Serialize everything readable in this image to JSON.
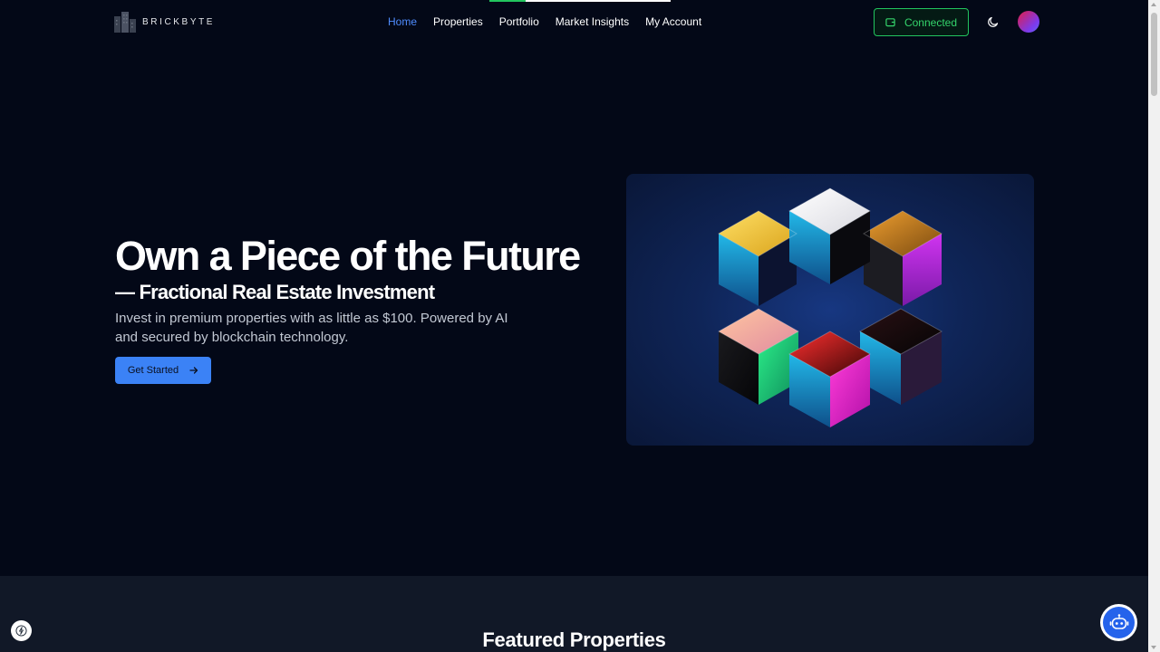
{
  "header": {
    "logo_text": "BRICKBYTE",
    "nav": [
      {
        "label": "Home",
        "active": true
      },
      {
        "label": "Properties",
        "active": false
      },
      {
        "label": "Portfolio",
        "active": false
      },
      {
        "label": "Market Insights",
        "active": false
      },
      {
        "label": "My Account",
        "active": false
      }
    ],
    "wallet_status": "Connected",
    "wallet_icon": "wallet-icon",
    "theme_icon": "moon-icon"
  },
  "page_progress": 0.2,
  "hero": {
    "title": "Own a Piece of the Future",
    "subtitle": "— Fractional Real Estate Investment",
    "description": "Invest in premium properties with as little as $100. Powered by AI and secured by blockchain technology.",
    "cta_label": "Get Started",
    "cta_icon": "arrow-right-icon",
    "image_icon": "blockchain-cubes-illustration"
  },
  "featured": {
    "title": "Featured Properties"
  },
  "colors": {
    "background": "#030817",
    "accent": "#3b82f6",
    "connected": "#22c55e",
    "section_bg": "#111827"
  }
}
